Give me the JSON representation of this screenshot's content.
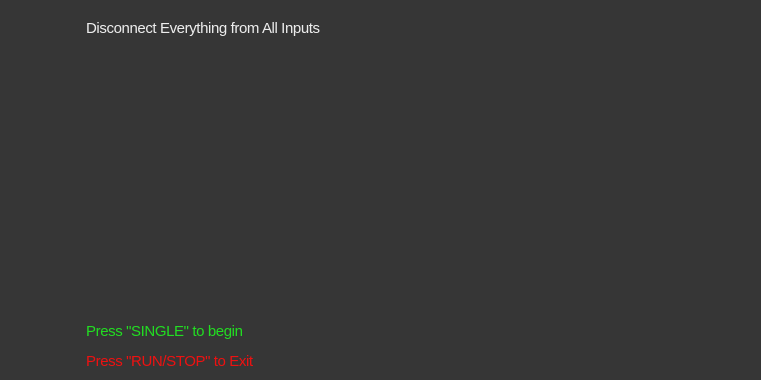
{
  "screen": {
    "instruction": "Disconnect Everything from All Inputs",
    "prompts": {
      "begin": "Press \"SINGLE\" to begin",
      "exit": "Press \"RUN/STOP\" to Exit"
    }
  },
  "colors": {
    "background": "#363636",
    "instruction_text": "#ececec",
    "begin_text": "#22dd22",
    "exit_text": "#ee1111"
  }
}
